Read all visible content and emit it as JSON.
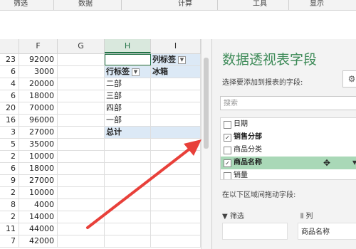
{
  "ribbon": {
    "groups": [
      "筛选",
      "数据",
      "计算",
      "工具",
      "显示"
    ]
  },
  "sheet": {
    "columns": [
      "F",
      "G",
      "H",
      "I"
    ],
    "rows": [
      {
        "num": "23",
        "f": "92000"
      },
      {
        "num": "6",
        "f": "3000"
      },
      {
        "num": "4",
        "f": "20000"
      },
      {
        "num": "6",
        "f": "18000"
      },
      {
        "num": "20",
        "f": "70000"
      },
      {
        "num": "16",
        "f": "96000"
      },
      {
        "num": "3",
        "f": "27000"
      },
      {
        "num": "5",
        "f": "35000"
      },
      {
        "num": "2",
        "f": "10000"
      },
      {
        "num": "6",
        "f": "18000"
      },
      {
        "num": "9",
        "f": "27000"
      },
      {
        "num": "2",
        "f": "10000"
      },
      {
        "num": "8",
        "f": "4000"
      },
      {
        "num": "2",
        "f": "14000"
      },
      {
        "num": "11",
        "f": "44000"
      },
      {
        "num": "7",
        "f": "42000"
      }
    ]
  },
  "pivot": {
    "col_label_header": "列标签",
    "row_label_header": "行标签",
    "col_item": "冰箱",
    "row_items": [
      "二部",
      "三部",
      "四部",
      "一部"
    ],
    "total_label": "总计"
  },
  "pane": {
    "title": "数据透视表字段",
    "subtitle": "选择要添加到报表的字段:",
    "search_placeholder": "搜索",
    "fields": [
      {
        "label": "日期",
        "checked": false
      },
      {
        "label": "销售分部",
        "checked": true
      },
      {
        "label": "商品分类",
        "checked": false
      },
      {
        "label": "商品名称",
        "checked": true
      },
      {
        "label": "销量",
        "checked": false
      }
    ],
    "drag_hint": "在以下区域间拖动字段:",
    "filter_area": "筛选",
    "column_area": "列",
    "column_field": "商品名称"
  },
  "colors": {
    "accent": "#217346",
    "pane_title": "#3c8a57",
    "highlight": "#a9d8b7",
    "arrow": "#e8403a"
  }
}
